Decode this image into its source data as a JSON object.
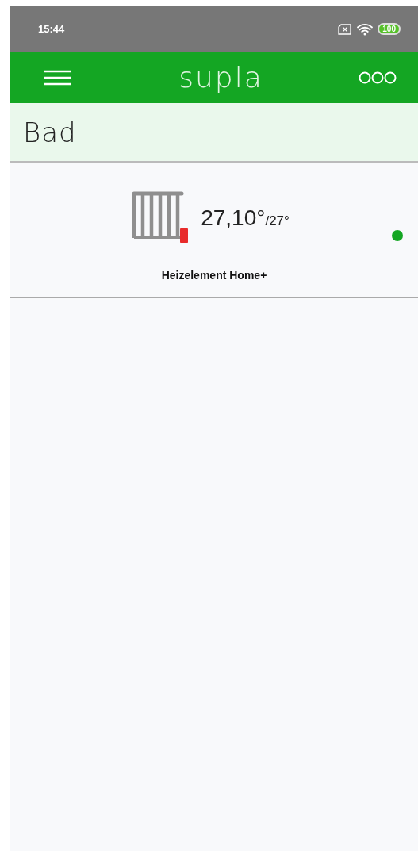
{
  "status_bar": {
    "time": "15:44",
    "battery": "100"
  },
  "app_bar": {
    "title": "supla"
  },
  "location": {
    "name": "Bad"
  },
  "channels": [
    {
      "kind": "heater",
      "temperature": "27,10°",
      "target": "/27°",
      "name": "Heizelement Home+",
      "online": true
    }
  ]
}
